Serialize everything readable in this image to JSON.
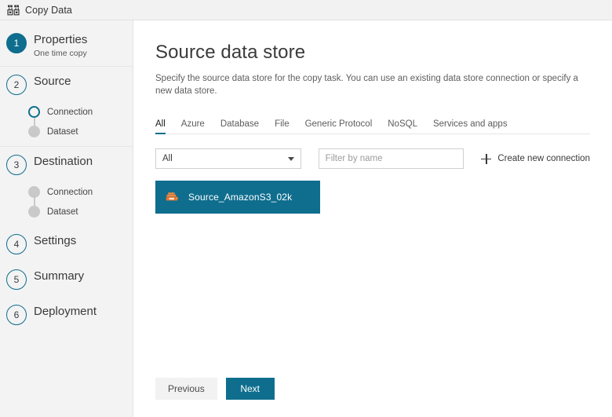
{
  "window": {
    "title": "Copy Data",
    "icon": "copy-data-icon"
  },
  "sidebar": {
    "steps": [
      {
        "number": "1",
        "label": "Properties",
        "sublabel": "One time copy",
        "state": "completed",
        "substeps": []
      },
      {
        "number": "2",
        "label": "Source",
        "sublabel": "",
        "state": "current",
        "substeps": [
          {
            "label": "Connection",
            "state": "current"
          },
          {
            "label": "Dataset",
            "state": "pending"
          }
        ]
      },
      {
        "number": "3",
        "label": "Destination",
        "sublabel": "",
        "state": "pending",
        "substeps": [
          {
            "label": "Connection",
            "state": "pending"
          },
          {
            "label": "Dataset",
            "state": "pending"
          }
        ]
      },
      {
        "number": "4",
        "label": "Settings",
        "sublabel": "",
        "state": "pending",
        "substeps": []
      },
      {
        "number": "5",
        "label": "Summary",
        "sublabel": "",
        "state": "pending",
        "substeps": []
      },
      {
        "number": "6",
        "label": "Deployment",
        "sublabel": "",
        "state": "pending",
        "substeps": []
      }
    ]
  },
  "main": {
    "title": "Source data store",
    "description": "Specify the source data store for the copy task. You can use an existing data store connection or specify a new data store.",
    "tabs": [
      {
        "label": "All",
        "active": true
      },
      {
        "label": "Azure",
        "active": false
      },
      {
        "label": "Database",
        "active": false
      },
      {
        "label": "File",
        "active": false
      },
      {
        "label": "Generic Protocol",
        "active": false
      },
      {
        "label": "NoSQL",
        "active": false
      },
      {
        "label": "Services and apps",
        "active": false
      }
    ],
    "filters": {
      "category_select_value": "All",
      "name_filter_value": "",
      "name_filter_placeholder": "Filter by name",
      "create_new_label": "Create new connection",
      "create_new_icon": "plus-icon"
    },
    "connections": [
      {
        "name": "Source_AmazonS3_02k",
        "icon": "amazon-s3-icon",
        "selected": true
      }
    ]
  },
  "footer": {
    "previous_label": "Previous",
    "next_label": "Next"
  },
  "colors": {
    "accent": "#0f6e8e",
    "sidebar_bg": "#f3f3f3",
    "titlebar_bg": "#f2f2f2",
    "s3_orange": "#e8762c"
  }
}
